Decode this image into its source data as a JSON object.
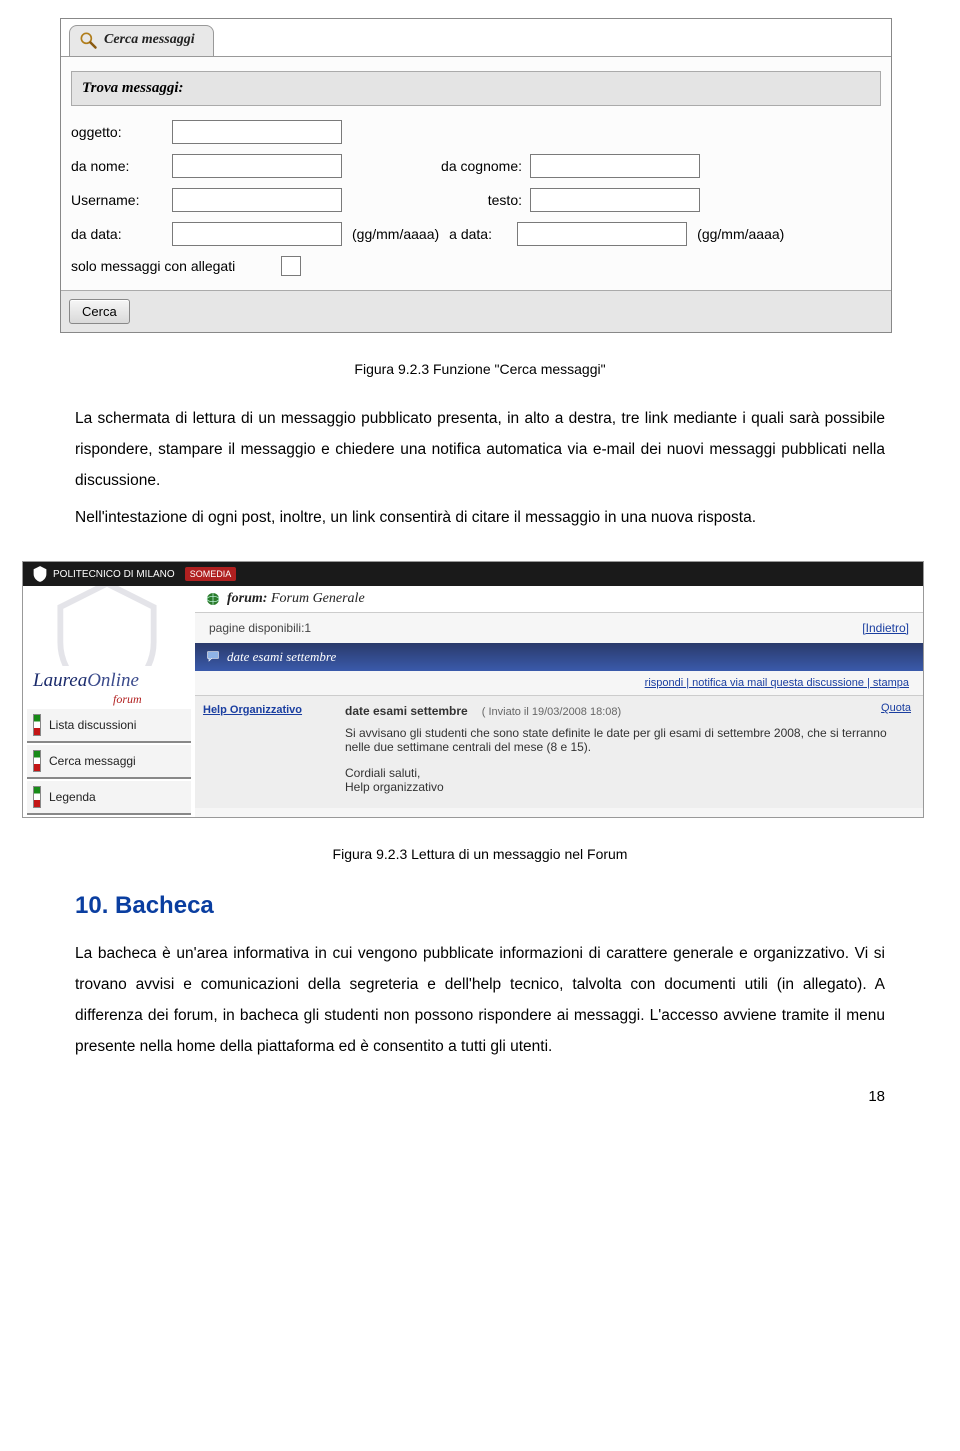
{
  "search_form": {
    "tab_label": "Cerca messaggi",
    "heading": "Trova messaggi:",
    "labels": {
      "oggetto": "oggetto:",
      "da_nome": "da nome:",
      "da_cognome": "da cognome:",
      "username": "Username:",
      "testo": "testo:",
      "da_data": "da data:",
      "a_data": "a data:",
      "solo_allegati": "solo messaggi con allegati"
    },
    "date_hint": "(gg/mm/aaaa)",
    "button": "Cerca"
  },
  "caption1": "Figura 9.2.3 Funzione \"Cerca messaggi\"",
  "paragraph1": "La schermata di lettura di un messaggio pubblicato presenta, in alto a destra, tre link mediante i quali sarà possibile rispondere, stampare il messaggio e chiedere una notifica automatica via e-mail dei nuovi messaggi pubblicati nella discussione.",
  "paragraph2": "Nell'intestazione di ogni post, inoltre, un link consentirà di citare il messaggio in una nuova risposta.",
  "forum": {
    "topbar_text": "POLITECNICO DI MILANO",
    "somedia": "SOMEDIA",
    "brand_main": "Laurea",
    "brand_online": "Online",
    "brand_sub": "forum",
    "sidebar": [
      "Lista discussioni",
      "Cerca messaggi",
      "Legenda"
    ],
    "forum_label": "forum:",
    "forum_name": "Forum Generale",
    "pages_label": "pagine disponibili:1",
    "back_link": "[Indietro]",
    "thread_title": "date esami settembre",
    "action_links": "rispondi | notifica via mail questa discussione | stampa",
    "author": "Help Organizzativo",
    "subject": "date esami settembre",
    "sent_meta": "( Inviato il 19/03/2008 18:08)",
    "quota": "Quota",
    "body1": "Si avvisano gli studenti che sono state definite le date per gli esami di settembre 2008, che si terranno nelle due settimane centrali del mese (8 e 15).",
    "body2": "Cordiali saluti,",
    "body3": "Help organizzativo"
  },
  "caption2": "Figura 9.2.3 Lettura di un messaggio nel Forum",
  "section10_title": "10. Bacheca",
  "section10_body": "La bacheca è un'area informativa in cui vengono pubblicate informazioni di carattere generale e organizzativo. Vi si trovano avvisi e comunicazioni della segreteria e dell'help tecnico, talvolta con documenti utili (in allegato). A differenza dei forum, in bacheca gli studenti non possono rispondere ai messaggi. L'accesso avviene tramite il menu presente nella home della piattaforma ed è consentito a tutti gli utenti.",
  "page_number": "18"
}
